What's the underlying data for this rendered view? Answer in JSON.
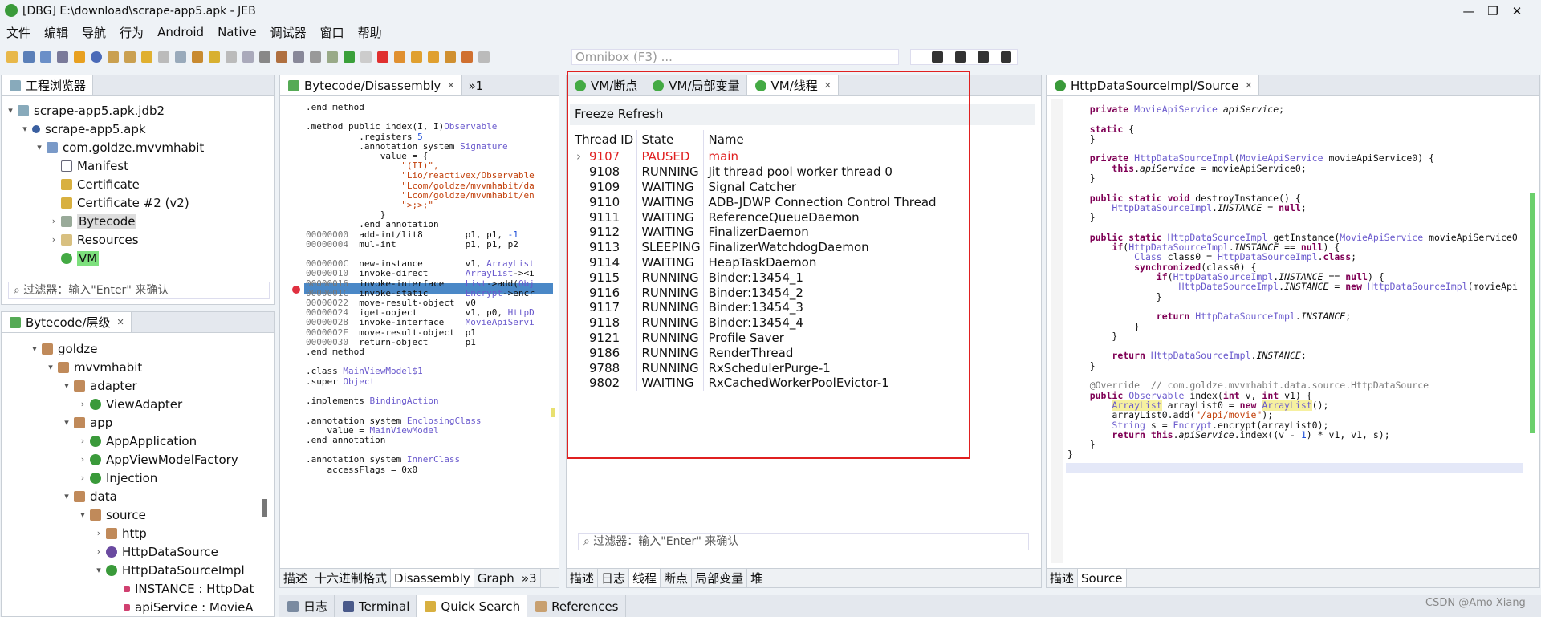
{
  "window": {
    "title": "[DBG] E:\\download\\scrape-app5.apk - JEB",
    "minimize": "—",
    "maximize": "❐",
    "close": "✕"
  },
  "menu": [
    "文件",
    "编辑",
    "导航",
    "行为",
    "Android",
    "Native",
    "调试器",
    "窗口",
    "帮助"
  ],
  "omnibox": {
    "placeholder": "Omnibox (F3) ..."
  },
  "project": {
    "tab": "工程浏览器",
    "items": [
      "scrape-app5.apk.jdb2",
      "scrape-app5.apk",
      "com.goldze.mvvmhabit",
      "Manifest",
      "Certificate",
      "Certificate #2 (v2)",
      "Bytecode",
      "Resources",
      "VM"
    ],
    "filter": "过滤器：输入\"Enter\" 来确认"
  },
  "hierarchy": {
    "tab": "Bytecode/层级",
    "items": [
      "goldze",
      "mvvmhabit",
      "adapter",
      "ViewAdapter",
      "app",
      "AppApplication",
      "AppViewModelFactory",
      "Injection",
      "data",
      "source",
      "http",
      "HttpDataSource",
      "HttpDataSourceImpl",
      "INSTANCE : HttpDat",
      "apiService : MovieA"
    ]
  },
  "disasm": {
    "tab": "Bytecode/Disassembly",
    "more": "»1",
    "bottom_tabs": [
      "描述",
      "十六进制格式",
      "Disassembly",
      "Graph",
      "»3"
    ]
  },
  "vm": {
    "tabs": [
      "VM/断点",
      "VM/局部变量",
      "VM/线程"
    ],
    "toolbar": "Freeze Refresh",
    "columns": [
      "Thread ID",
      "State",
      "Name"
    ],
    "threads": [
      {
        "id": "9107",
        "state": "PAUSED",
        "name": "main"
      },
      {
        "id": "9108",
        "state": "RUNNING",
        "name": "Jit thread pool worker thread 0"
      },
      {
        "id": "9109",
        "state": "WAITING",
        "name": "Signal Catcher"
      },
      {
        "id": "9110",
        "state": "WAITING",
        "name": "ADB-JDWP Connection Control Thread"
      },
      {
        "id": "9111",
        "state": "WAITING",
        "name": "ReferenceQueueDaemon"
      },
      {
        "id": "9112",
        "state": "WAITING",
        "name": "FinalizerDaemon"
      },
      {
        "id": "9113",
        "state": "SLEEPING",
        "name": "FinalizerWatchdogDaemon"
      },
      {
        "id": "9114",
        "state": "WAITING",
        "name": "HeapTaskDaemon"
      },
      {
        "id": "9115",
        "state": "RUNNING",
        "name": "Binder:13454_1"
      },
      {
        "id": "9116",
        "state": "RUNNING",
        "name": "Binder:13454_2"
      },
      {
        "id": "9117",
        "state": "RUNNING",
        "name": "Binder:13454_3"
      },
      {
        "id": "9118",
        "state": "RUNNING",
        "name": "Binder:13454_4"
      },
      {
        "id": "9121",
        "state": "RUNNING",
        "name": "Profile Saver"
      },
      {
        "id": "9186",
        "state": "RUNNING",
        "name": "RenderThread"
      },
      {
        "id": "9788",
        "state": "RUNNING",
        "name": "RxSchedulerPurge-1"
      },
      {
        "id": "9802",
        "state": "WAITING",
        "name": "RxCachedWorkerPoolEvictor-1"
      }
    ],
    "filter": "过滤器：输入\"Enter\" 来确认",
    "bottom_tabs": [
      "描述",
      "日志",
      "线程",
      "断点",
      "局部变量",
      "堆"
    ]
  },
  "source": {
    "tab": "HttpDataSourceImpl/Source",
    "bottom_tabs": [
      "描述",
      "Source"
    ]
  },
  "console": {
    "tabs": [
      "日志",
      "Terminal",
      "Quick Search",
      "References"
    ]
  },
  "watermark": "CSDN @Amo Xiang",
  "colors": {
    "highlight_box": "#e02020",
    "paused": "#e02020",
    "selected_row": "#4a88c7"
  }
}
